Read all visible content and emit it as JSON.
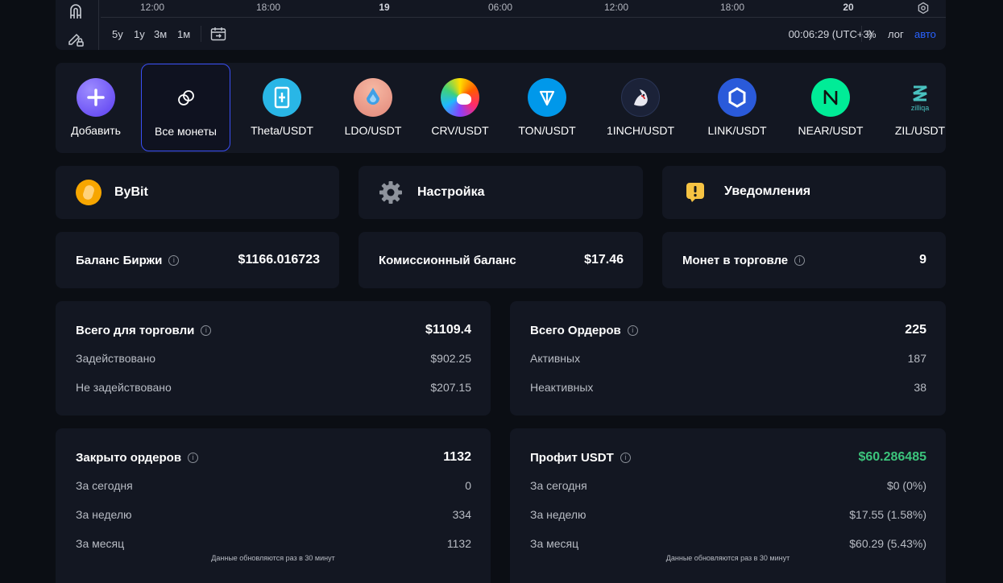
{
  "chart_toolbar": {
    "time_ticks": [
      "12:00",
      "18:00",
      "19",
      "06:00",
      "12:00",
      "18:00",
      "20"
    ],
    "ranges": [
      "5y",
      "1y",
      "3м",
      "1м"
    ],
    "clock": "00:06:29 (UTC+3)",
    "percent_label": "%",
    "log_label": "лог",
    "auto_label": "авто"
  },
  "coins": [
    {
      "label": "Добавить",
      "icon": "plus-icon"
    },
    {
      "label": "Все монеты",
      "icon": "coins-icon"
    },
    {
      "label": "Theta/USDT",
      "icon": "theta-logo"
    },
    {
      "label": "LDO/USDT",
      "icon": "lido-logo"
    },
    {
      "label": "CRV/USDT",
      "icon": "curve-logo"
    },
    {
      "label": "TON/USDT",
      "icon": "ton-logo"
    },
    {
      "label": "1INCH/USDT",
      "icon": "1inch-logo"
    },
    {
      "label": "LINK/USDT",
      "icon": "chainlink-logo"
    },
    {
      "label": "NEAR/USDT",
      "icon": "near-logo"
    },
    {
      "label": "ZIL/USDT",
      "icon": "zilliqa-logo",
      "logo_text": "zilliqa"
    }
  ],
  "nav_cards": {
    "exchange": "ByBit",
    "settings": "Настройка",
    "notifications": "Уведомления"
  },
  "stats": {
    "exchange_balance": {
      "label": "Баланс Биржи",
      "value": "$1166.016723"
    },
    "commission_balance": {
      "label": "Комиссионный баланс",
      "value": "$17.46"
    },
    "coins_in_trade": {
      "label": "Монет в торговле",
      "value": "9"
    }
  },
  "trading": {
    "title": "Всего для торговли",
    "total": "$1109.4",
    "rows": [
      {
        "label": "Задействовано",
        "value": "$902.25"
      },
      {
        "label": "Не задействовано",
        "value": "$207.15"
      }
    ]
  },
  "orders": {
    "title": "Всего Ордеров",
    "total": "225",
    "rows": [
      {
        "label": "Активных",
        "value": "187"
      },
      {
        "label": "Неактивных",
        "value": "38"
      }
    ]
  },
  "closed": {
    "title": "Закрыто ордеров",
    "total": "1132",
    "rows": [
      {
        "label": "За сегодня",
        "value": "0"
      },
      {
        "label": "За неделю",
        "value": "334"
      },
      {
        "label": "За месяц",
        "value": "1132"
      }
    ],
    "note": "Данные обновляются раз в 30 минут"
  },
  "profit": {
    "title": "Профит USDT",
    "total": "$60.286485",
    "total_color": "#3cc47c",
    "rows": [
      {
        "label": "За сегодня",
        "value": "$0 (0%)"
      },
      {
        "label": "За неделю",
        "value": "$17.55 (1.58%)"
      },
      {
        "label": "За месяц",
        "value": "$60.29 (5.43%)"
      }
    ],
    "note": "Данные обновляются раз в 30 минут"
  },
  "info_glyph": "i"
}
